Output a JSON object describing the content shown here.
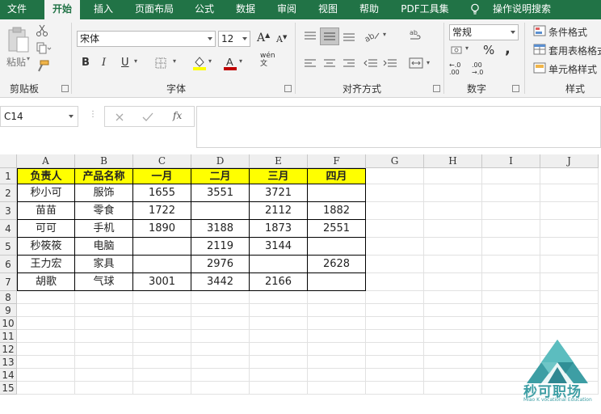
{
  "ribbon_tabs": [
    "文件",
    "开始",
    "插入",
    "页面布局",
    "公式",
    "数据",
    "审阅",
    "视图",
    "帮助",
    "PDF工具集",
    "操作说明搜索"
  ],
  "active_tab": "开始",
  "clipboard": {
    "paste_label": "粘贴",
    "group_label": "剪贴板"
  },
  "font": {
    "name": "宋体",
    "size": "12",
    "group_label": "字体",
    "phonetic": "wén",
    "bold": "B",
    "italic": "I",
    "underline": "U",
    "grow": "A",
    "shrink": "A"
  },
  "alignment": {
    "group_label": "对齐方式"
  },
  "number": {
    "format": "常规",
    "percent": "%",
    "comma": ",",
    "group_label": "数字",
    "inc_decimal": "←.0\n.00",
    "dec_decimal": ".00\n→.0"
  },
  "styles": {
    "conditional": "条件格式",
    "table": "套用表格格式",
    "cell": "单元格样式",
    "group_label": "样式"
  },
  "namebox": "C14",
  "fx_label": "fx",
  "columns": [
    "A",
    "B",
    "C",
    "D",
    "E",
    "F",
    "G",
    "H",
    "I",
    "J"
  ],
  "rows": [
    "1",
    "2",
    "3",
    "4",
    "5",
    "6",
    "7",
    "8",
    "9",
    "10",
    "11",
    "12",
    "13",
    "14",
    "15"
  ],
  "table": {
    "headers": [
      "负责人",
      "产品名称",
      "一月",
      "二月",
      "三月",
      "四月"
    ],
    "rows": [
      [
        "秒小可",
        "服饰",
        "1655",
        "3551",
        "3721",
        ""
      ],
      [
        "苗苗",
        "零食",
        "1722",
        "",
        "2112",
        "1882"
      ],
      [
        "可可",
        "手机",
        "1890",
        "3188",
        "1873",
        "2551"
      ],
      [
        "秒筱筱",
        "电脑",
        "",
        "2119",
        "3144",
        ""
      ],
      [
        "王力宏",
        "家具",
        "",
        "2976",
        "",
        "2628"
      ],
      [
        "胡歌",
        "气球",
        "3001",
        "3442",
        "2166",
        ""
      ]
    ]
  },
  "watermark": {
    "title": "秒可职场",
    "subtitle": "Miao K vocational Education"
  },
  "colors": {
    "brand_green": "#217346",
    "header_fill": "#ffff00",
    "watermark": "#4aa3a6"
  }
}
